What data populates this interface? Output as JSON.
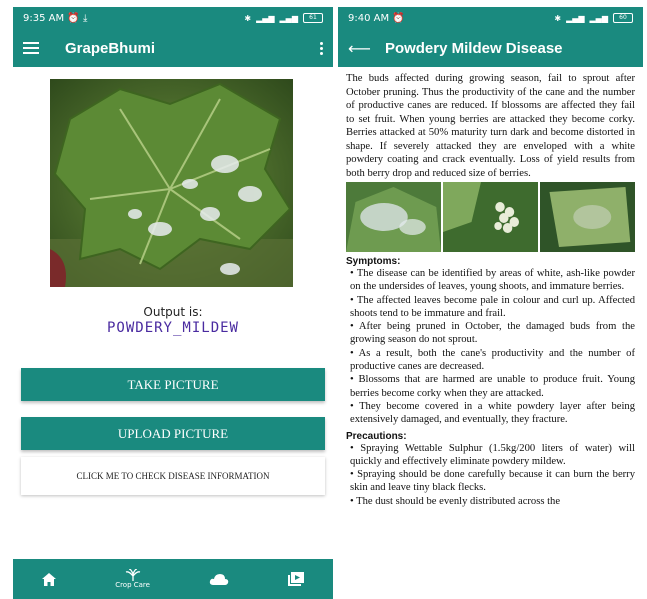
{
  "left": {
    "status": {
      "time": "9:35 AM",
      "battery": "61"
    },
    "appbar": {
      "title": "GrapeBhumi"
    },
    "output": {
      "label": "Output is:",
      "value": "POWDERY_MILDEW"
    },
    "buttons": {
      "take": "TAKE PICTURE",
      "upload": "UPLOAD PICTURE"
    },
    "info_card": "CLICK ME TO CHECK DISEASE INFORMATION",
    "nav": {
      "crop_care": "Crop Care"
    }
  },
  "right": {
    "status": {
      "time": "9:40 AM",
      "battery": "60"
    },
    "appbar": {
      "title": "Powdery Mildew Disease"
    },
    "intro": "The buds affected during growing season, fail to sprout after October pruning. Thus the productivity of the cane and the number of productive canes are reduced. If blossoms are affected they fail to set fruit. When young berries are attacked they become corky. Berries attacked at 50% maturity turn dark and become distorted in shape. If severely attacked they are enveloped with a white powdery coating and crack eventually. Loss of yield results from both berry drop and reduced size of berries.",
    "symptoms_heading": "Symptoms:",
    "symptoms": [
      "• The disease can be identified by areas of white, ash-like powder on the undersides of leaves, young shoots, and immature berries.",
      "• The affected leaves become pale in colour and curl up. Affected shoots tend to be immature and frail.",
      "• After being pruned in October, the damaged buds from the growing season do not sprout.",
      "• As a result, both the cane's productivity and the number of productive canes are decreased.",
      "• Blossoms that are harmed are unable to produce fruit. Young berries become corky when they are attacked.",
      "• They become covered in a white powdery layer after being extensively damaged, and eventually, they fracture."
    ],
    "precautions_heading": "Precautions:",
    "precautions": [
      "• Spraying Wettable Sulphur (1.5kg/200 liters of water) will quickly and effectively eliminate powdery mildew.",
      "• Spraying should be done carefully because it can burn the berry skin and leave tiny black flecks.",
      "• The dust should be evenly distributed across the"
    ]
  },
  "colors": {
    "primary": "#1a8a7f",
    "output_text": "#4a2ba0"
  },
  "icons": [
    "alarm-icon",
    "download-icon",
    "bluetooth-icon",
    "signal-icon",
    "battery-icon",
    "menu-icon",
    "more-vert-icon",
    "back-arrow-icon",
    "home-icon",
    "crop-care-icon",
    "cloud-icon",
    "video-library-icon"
  ]
}
